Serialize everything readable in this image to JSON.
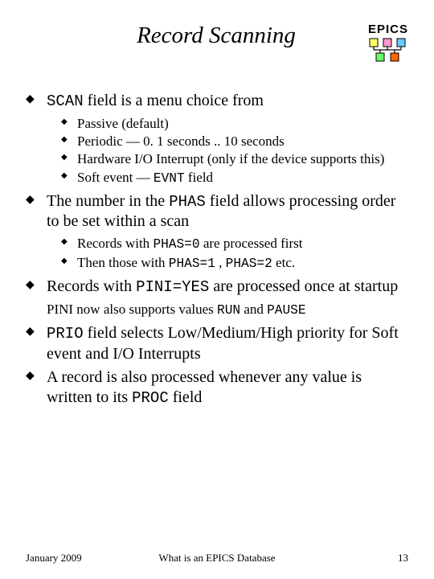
{
  "header": {
    "title": "Record Scanning",
    "logo_text": "EPICS"
  },
  "bullets": {
    "b1_pre": "SCAN",
    "b1_post": " field is a menu choice from",
    "b1_sub1": "Passive (default)",
    "b1_sub2": "Periodic — 0. 1 seconds .. 10 seconds",
    "b1_sub3": "Hardware I/O Interrupt (only if the device supports this)",
    "b1_sub4_pre": "Soft event — ",
    "b1_sub4_mono": "EVNT",
    "b1_sub4_post": " field",
    "b2_pre": "The number in the ",
    "b2_mono": "PHAS",
    "b2_post": " field allows processing order to be set within a scan",
    "b2_sub1_pre": "Records with ",
    "b2_sub1_mono": "PHAS=0",
    "b2_sub1_post": " are processed first",
    "b2_sub2_pre": "Then those with ",
    "b2_sub2_mono1": "PHAS=1",
    "b2_sub2_mid": " , ",
    "b2_sub2_mono2": "PHAS=2",
    "b2_sub2_post": " etc.",
    "b3_pre": "Records with ",
    "b3_mono": "PINI=YES",
    "b3_post": " are processed once at startup",
    "b3_note_pre": "PINI now also supports values ",
    "b3_note_mono1": "RUN",
    "b3_note_mid": " and ",
    "b3_note_mono2": "PAUSE",
    "b4_mono": "PRIO",
    "b4_post": " field selects Low/Medium/High priority for Soft event and I/O Interrupts",
    "b5_pre": "A record is also processed whenever any value is written to its ",
    "b5_mono": "PROC",
    "b5_post": " field"
  },
  "footer": {
    "left": "January 2009",
    "center": "What is an EPICS Database",
    "right": "13"
  }
}
